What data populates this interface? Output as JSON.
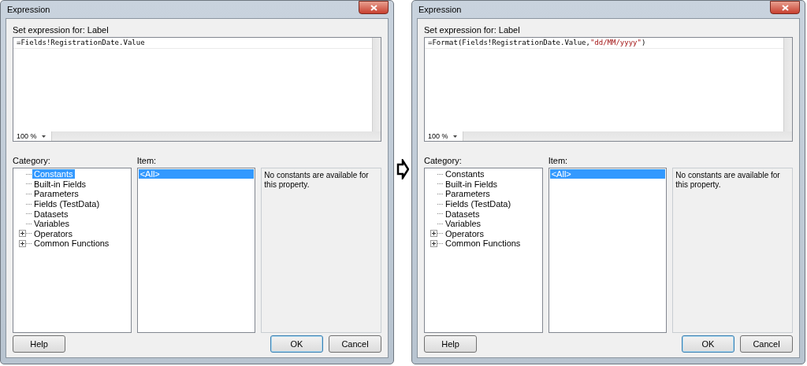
{
  "dialogs": [
    {
      "title": "Expression",
      "prompt": "Set expression for: Label",
      "expression": [
        {
          "kind": "code",
          "text": "=Fields!RegistrationDate.Value"
        }
      ],
      "zoom": "100 %",
      "category_label": "Category:",
      "categories": [
        {
          "label": "Constants",
          "selected": true,
          "expandable": false
        },
        {
          "label": "Built-in Fields",
          "selected": false,
          "expandable": false
        },
        {
          "label": "Parameters",
          "selected": false,
          "expandable": false
        },
        {
          "label": "Fields (TestData)",
          "selected": false,
          "expandable": false
        },
        {
          "label": "Datasets",
          "selected": false,
          "expandable": false
        },
        {
          "label": "Variables",
          "selected": false,
          "expandable": false
        },
        {
          "label": "Operators",
          "selected": false,
          "expandable": true
        },
        {
          "label": "Common Functions",
          "selected": false,
          "expandable": true
        }
      ],
      "item_label": "Item:",
      "items": [
        {
          "label": "<All>",
          "selected": true
        }
      ],
      "description": "No constants are available for this property.",
      "buttons": [
        {
          "label": "Help",
          "kind": "plain"
        },
        {
          "label": "OK",
          "kind": "default"
        },
        {
          "label": "Cancel",
          "kind": "plain"
        }
      ]
    },
    {
      "title": "Expression",
      "prompt": "Set expression for: Label",
      "expression": [
        {
          "kind": "code",
          "text": "=Format(Fields!RegistrationDate.Value,"
        },
        {
          "kind": "string",
          "text": "\"dd/MM/yyyy\""
        },
        {
          "kind": "code",
          "text": ")"
        }
      ],
      "zoom": "100 %",
      "category_label": "Category:",
      "categories": [
        {
          "label": "Constants",
          "selected": false,
          "expandable": false
        },
        {
          "label": "Built-in Fields",
          "selected": false,
          "expandable": false
        },
        {
          "label": "Parameters",
          "selected": false,
          "expandable": false
        },
        {
          "label": "Fields (TestData)",
          "selected": false,
          "expandable": false
        },
        {
          "label": "Datasets",
          "selected": false,
          "expandable": false
        },
        {
          "label": "Variables",
          "selected": false,
          "expandable": false
        },
        {
          "label": "Operators",
          "selected": false,
          "expandable": true
        },
        {
          "label": "Common Functions",
          "selected": false,
          "expandable": true
        }
      ],
      "item_label": "Item:",
      "items": [
        {
          "label": "<All>",
          "selected": true
        }
      ],
      "description": "No constants are available for this property.",
      "buttons": [
        {
          "label": "Help",
          "kind": "plain"
        },
        {
          "label": "OK",
          "kind": "default"
        },
        {
          "label": "Cancel",
          "kind": "plain"
        }
      ]
    }
  ]
}
